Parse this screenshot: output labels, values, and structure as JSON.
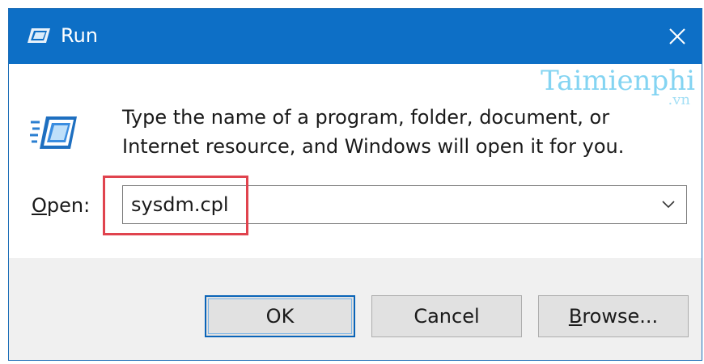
{
  "window": {
    "title": "Run",
    "close_glyph": "✕",
    "titlebar_color": "#0d6fc6"
  },
  "watermark": {
    "main": "Taimienphi",
    "sub": ".vn"
  },
  "content": {
    "icon": "run-dialog-icon",
    "description": "Type the name of a program, folder, document, or Internet resource, and Windows will open it for you.",
    "open_label_underlined": "O",
    "open_label_rest": "pen:",
    "open_value": "sysdm.cpl",
    "highlight_color": "#e0434e"
  },
  "buttons": {
    "ok": "OK",
    "cancel": "Cancel",
    "browse_underlined": "B",
    "browse_rest": "rowse..."
  }
}
